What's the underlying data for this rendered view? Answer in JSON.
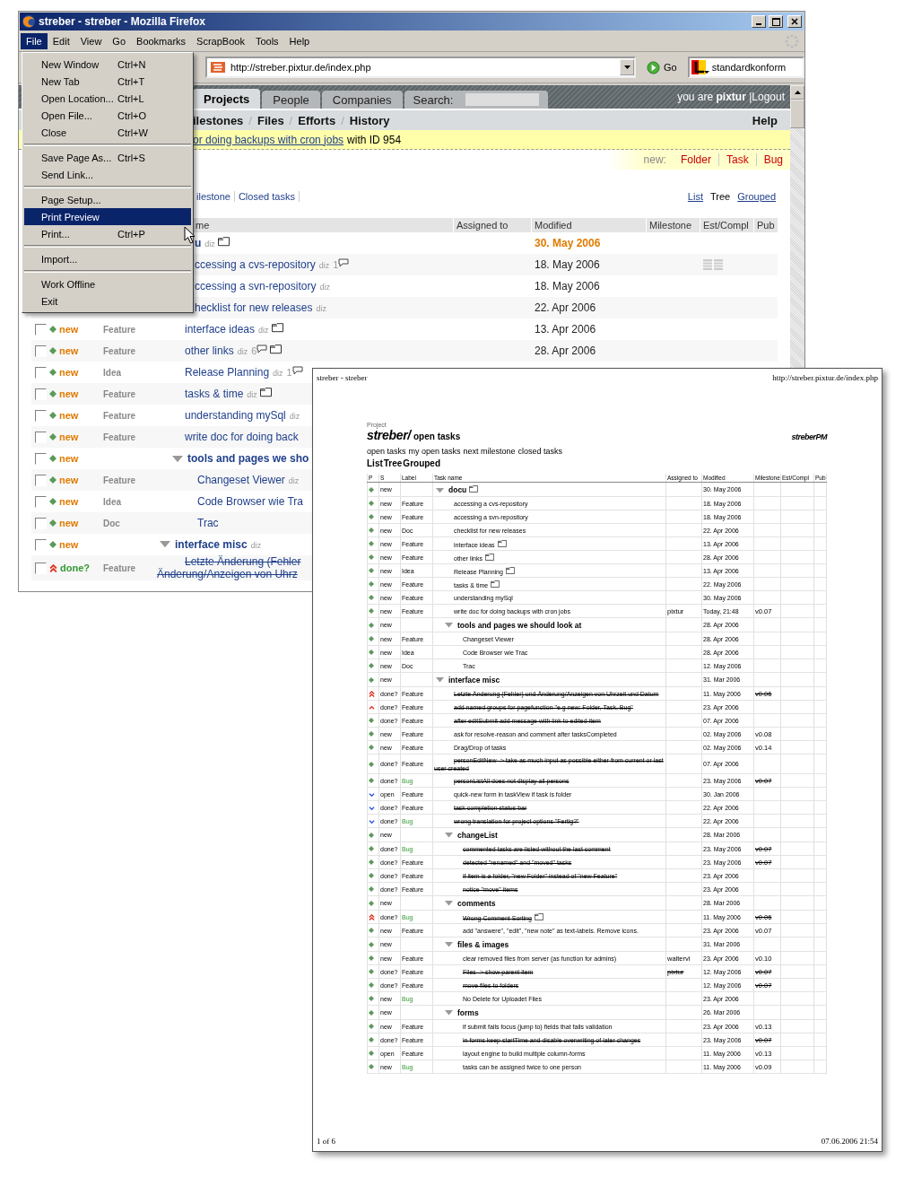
{
  "window": {
    "title": "streber - streber - Mozilla Firefox"
  },
  "menu_bar": [
    {
      "label": "File",
      "selected": true
    },
    {
      "label": "Edit",
      "selected": false
    },
    {
      "label": "View",
      "selected": false
    },
    {
      "label": "Go",
      "selected": false
    },
    {
      "label": "Bookmarks",
      "selected": false
    },
    {
      "label": "ScrapBook",
      "selected": false
    },
    {
      "label": "Tools",
      "selected": false
    },
    {
      "label": "Help",
      "selected": false
    }
  ],
  "file_menu": [
    [
      {
        "label": "New Window",
        "shortcut": "Ctrl+N",
        "selected": false
      },
      {
        "label": "New Tab",
        "shortcut": "Ctrl+T",
        "selected": false
      },
      {
        "label": "Open Location...",
        "shortcut": "Ctrl+L",
        "selected": false
      },
      {
        "label": "Open File...",
        "shortcut": "Ctrl+O",
        "selected": false
      },
      {
        "label": "Close",
        "shortcut": "Ctrl+W",
        "selected": false
      }
    ],
    [
      {
        "label": "Save Page As...",
        "shortcut": "Ctrl+S",
        "selected": false
      },
      {
        "label": "Send Link...",
        "selected": false
      }
    ],
    [
      {
        "label": "Page Setup...",
        "selected": false
      },
      {
        "label": "Print Preview",
        "selected": true
      },
      {
        "label": "Print...",
        "shortcut": "Ctrl+P",
        "selected": false
      }
    ],
    [
      {
        "label": "Import...",
        "selected": false
      }
    ],
    [
      {
        "label": "Work Offline",
        "selected": false
      },
      {
        "label": "Exit",
        "selected": false
      }
    ]
  ],
  "toolbar": {
    "url": "http://streber.pixtur.de/index.php",
    "go": "Go",
    "search_engine": "standardkonform"
  },
  "page": {
    "tabs": [
      {
        "label": "Projects",
        "selected": true
      },
      {
        "label": "People",
        "selected": false
      },
      {
        "label": "Companies",
        "selected": false
      }
    ],
    "search": {
      "label": "Search:"
    },
    "user": {
      "text": "you are **pixtur**",
      "logout": "|Logout"
    },
    "subnav": [
      {
        "label": "ilestones"
      },
      {
        "separator": "/",
        "label": "Files"
      },
      {
        "separator": "/",
        "label": "Efforts"
      },
      {
        "separator": "/",
        "label": "History"
      }
    ],
    "help": "Help",
    "message": {
      "link": "or doing backups with cron jobs",
      "text": "with ID 954"
    },
    "new_bar": {
      "label": "new:",
      "links": [
        "Folder",
        "Task",
        "Bug"
      ]
    },
    "view_tabs": [
      "ilestone",
      "Closed tasks"
    ],
    "view_modes": [
      {
        "label": "List",
        "selected": false
      },
      {
        "label": "Tree",
        "selected": true
      },
      {
        "label": "Grouped",
        "selected": false
      }
    ],
    "table": {
      "columns": [
        "me",
        "Assigned to",
        "Modified",
        "Milestone",
        "Est/Compl",
        "Pub"
      ],
      "rows": [
        {
          "kind": "folder",
          "name": "u",
          "diz": "diz",
          "folder_icon": true,
          "est_icon": false,
          "modified": "30. May 2006",
          "children": [
            {
              "kind": "task",
              "name": "ccessing a cvs-repository",
              "diz": "diz",
              "comments": "1",
              "folder_icon": false,
              "est_icon": true,
              "modified": "18. May 2006"
            },
            {
              "kind": "task",
              "name": "ccessing a svn-repository",
              "diz": "diz",
              "folder_icon": false,
              "est_icon": false,
              "modified": "18. May 2006"
            },
            {
              "kind": "task",
              "name": "hecklist for new releases",
              "diz": "diz",
              "folder_icon": false,
              "est_icon": false,
              "modified": "22. Apr 2006"
            },
            {
              "kind": "task",
              "checked": false,
              "priority": {
                "kind": "normal"
              },
              "status": "new",
              "label": "Feature",
              "name": "interface ideas",
              "diz": "diz",
              "folder_icon": true,
              "est_icon": false,
              "modified": "13. Apr 2006"
            },
            {
              "kind": "task",
              "checked": false,
              "priority": {
                "kind": "normal"
              },
              "status": "new",
              "label": "Feature",
              "name": "other links",
              "diz": "diz",
              "comments": "6",
              "folder_icon": true,
              "est_icon": false,
              "modified": "28. Apr 2006"
            },
            {
              "kind": "task",
              "checked": false,
              "priority": {
                "kind": "normal"
              },
              "status": "new",
              "label": "Idea",
              "name": "Release Planning",
              "diz": "diz",
              "comments": "1",
              "folder_icon": false,
              "est_icon": false
            },
            {
              "kind": "task",
              "checked": false,
              "priority": {
                "kind": "normal"
              },
              "status": "new",
              "label": "Feature",
              "name": "tasks & time",
              "diz": "diz",
              "folder_icon": true,
              "est_icon": false
            },
            {
              "kind": "task",
              "checked": false,
              "priority": {
                "kind": "normal"
              },
              "status": "new",
              "label": "Feature",
              "name": "understanding mySql",
              "diz": "diz",
              "folder_icon": false,
              "est_icon": false
            },
            {
              "kind": "task",
              "checked": false,
              "priority": {
                "kind": "normal"
              },
              "status": "new",
              "label": "Feature",
              "name": "write doc for doing back",
              "folder_icon": false,
              "est_icon": false
            },
            {
              "kind": "folder",
              "checked": false,
              "priority": {
                "kind": "normal"
              },
              "status": "new",
              "name": "tools and pages we sho",
              "folder_icon": false,
              "est_icon": false,
              "children": [
                {
                  "kind": "task",
                  "checked": false,
                  "priority": {
                    "kind": "normal"
                  },
                  "status": "new",
                  "label": "Feature",
                  "name": "Changeset Viewer",
                  "diz": "diz",
                  "folder_icon": false,
                  "est_icon": false
                },
                {
                  "kind": "task",
                  "checked": false,
                  "priority": {
                    "kind": "normal"
                  },
                  "status": "new",
                  "label": "Idea",
                  "name": "Code Browser wie Tra",
                  "folder_icon": false,
                  "est_icon": false
                },
                {
                  "kind": "task",
                  "checked": false,
                  "priority": {
                    "kind": "normal"
                  },
                  "status": "new",
                  "label": "Doc",
                  "name": "Trac",
                  "folder_icon": false,
                  "est_icon": false
                }
              ]
            }
          ]
        },
        {
          "kind": "folder",
          "checked": false,
          "priority": {
            "kind": "normal"
          },
          "status": "new",
          "name": "interface misc",
          "diz": "diz",
          "folder_icon": false,
          "est_icon": false,
          "children": [
            {
              "kind": "task",
              "checked": false,
              "priority": {
                "kind": "high"
              },
              "status": "done?",
              "label": "Feature",
              "name": "Letzte Änderung (Fehler Änderung/Anzeigen von Uhrz",
              "done": true,
              "folder_icon": false,
              "est_icon": false
            }
          ]
        }
      ]
    }
  },
  "print_preview": {
    "page_title": "streber - streber",
    "page_url": "http://streber.pixtur.de/index.php",
    "project_label": "Project",
    "project": "streber/",
    "title": "open tasks",
    "logo": "streberPM",
    "nav": [
      "open tasks",
      "my open tasks",
      "next milestone",
      "closed tasks"
    ],
    "views": [
      "List",
      "Tree",
      "Grouped"
    ],
    "columns": [
      "P",
      "S",
      "Label",
      "Task name",
      "Assigned to",
      "Modified",
      "Milestone",
      "Est/Compl",
      "Pub"
    ],
    "rows": [
      {
        "kind": "folder",
        "priority": {
          "kind": "normal"
        },
        "status": "new",
        "name": "docu",
        "folder_icon": true,
        "done": false,
        "modified": "30. May 2006",
        "children": [
          {
            "kind": "task",
            "priority": {
              "kind": "normal"
            },
            "status": "new",
            "label": "Feature",
            "name": "accessing a cvs-repository",
            "done": false,
            "modified": "18. May 2006"
          },
          {
            "kind": "task",
            "priority": {
              "kind": "normal"
            },
            "status": "new",
            "label": "Feature",
            "name": "accessing a svn-repository",
            "done": false,
            "modified": "18. May 2006"
          },
          {
            "kind": "task",
            "priority": {
              "kind": "normal"
            },
            "status": "new",
            "label": "Doc",
            "name": "checklist for new releases",
            "done": false,
            "modified": "22. Apr 2006"
          },
          {
            "kind": "task",
            "priority": {
              "kind": "normal"
            },
            "status": "new",
            "label": "Feature",
            "name": "interface ideas",
            "folder_icon": true,
            "done": false,
            "modified": "13. Apr 2006"
          },
          {
            "kind": "task",
            "priority": {
              "kind": "normal"
            },
            "status": "new",
            "label": "Feature",
            "name": "other links",
            "folder_icon": true,
            "done": false,
            "modified": "28. Apr 2006"
          },
          {
            "kind": "task",
            "priority": {
              "kind": "normal"
            },
            "status": "new",
            "label": "Idea",
            "name": "Release Planning",
            "folder_icon": true,
            "done": false,
            "modified": "13. Apr 2006"
          },
          {
            "kind": "task",
            "priority": {
              "kind": "normal"
            },
            "status": "new",
            "label": "Feature",
            "name": "tasks & time",
            "folder_icon": true,
            "done": false,
            "modified": "22. May 2006"
          },
          {
            "kind": "task",
            "priority": {
              "kind": "normal"
            },
            "status": "new",
            "label": "Feature",
            "name": "understanding mySql",
            "done": false,
            "modified": "30. May 2006"
          },
          {
            "kind": "task",
            "priority": {
              "kind": "normal"
            },
            "status": "new",
            "label": "Feature",
            "name": "write doc for doing backups with cron jobs",
            "done": false,
            "assigned": "pixtur",
            "modified": "Today, 21:48",
            "milestone": "v0.07"
          },
          {
            "kind": "folder",
            "priority": {
              "kind": "normal"
            },
            "status": "new",
            "name": "tools and pages we should look at",
            "done": false,
            "modified": "28. Apr 2006",
            "children": [
              {
                "kind": "task",
                "priority": {
                  "kind": "normal"
                },
                "status": "new",
                "label": "Feature",
                "name": "Changeset Viewer",
                "done": false,
                "modified": "28. Apr 2006"
              },
              {
                "kind": "task",
                "priority": {
                  "kind": "normal"
                },
                "status": "new",
                "label": "Idea",
                "name": "Code Browser wie Trac",
                "done": false,
                "modified": "28. Apr 2006"
              },
              {
                "kind": "task",
                "priority": {
                  "kind": "normal"
                },
                "status": "new",
                "label": "Doc",
                "name": "Trac",
                "done": false,
                "modified": "12. May 2006"
              }
            ]
          }
        ]
      },
      {
        "kind": "folder",
        "priority": {
          "kind": "normal"
        },
        "status": "new",
        "name": "interface misc",
        "done": false,
        "modified": "31. Mar 2006",
        "children": [
          {
            "kind": "task",
            "priority": {
              "kind": "high"
            },
            "status": "done?",
            "label": "Feature",
            "name": "Letzte Änderung (Fehler) und Änderung/Anzeigen von Uhrzeit und Datum",
            "done": true,
            "modified": "11. May 2006",
            "milestone": "v0.06"
          },
          {
            "kind": "task",
            "priority": {
              "kind": "raised"
            },
            "status": "done?",
            "label": "Feature",
            "name": "add named groups for pagefunction \"e.g new: Folder, Task, Bug\"",
            "done": true,
            "modified": "23. Apr 2006"
          },
          {
            "kind": "task",
            "priority": {
              "kind": "normal"
            },
            "status": "done?",
            "label": "Feature",
            "name": "after editSubmit add message with link to edited item",
            "done": true,
            "modified": "07. Apr 2006"
          },
          {
            "kind": "task",
            "priority": {
              "kind": "normal"
            },
            "status": "new",
            "label": "Feature",
            "name": "ask for resolve-reason and comment after tasksCompleted",
            "done": false,
            "modified": "02. May 2006",
            "milestone": "v0.08"
          },
          {
            "kind": "task",
            "priority": {
              "kind": "normal"
            },
            "status": "new",
            "label": "Feature",
            "name": "Drag/Drop of tasks",
            "done": false,
            "modified": "02. May 2006",
            "milestone": "v0.14"
          },
          {
            "kind": "task",
            "priority": {
              "kind": "normal"
            },
            "status": "done?",
            "label": "Feature",
            "name": "personEditNew -> take as much input as possible either from current or last user created",
            "done": true,
            "modified": "07. Apr 2006"
          },
          {
            "kind": "bug",
            "priority": {
              "kind": "normal"
            },
            "status": "done?",
            "label": "Bug",
            "name": "personListAll does not display all persons",
            "done": true,
            "modified": "23. May 2006",
            "milestone": "v0.07"
          },
          {
            "kind": "task",
            "priority": {
              "kind": "low"
            },
            "status": "open",
            "label": "Feature",
            "name": "quick-new form in taskView if task is folder",
            "done": false,
            "modified": "30. Jan 2006"
          },
          {
            "kind": "task",
            "priority": {
              "kind": "low"
            },
            "status": "done?",
            "label": "Feature",
            "name": "task completion status bar",
            "done": true,
            "modified": "22. Apr 2006"
          },
          {
            "kind": "bug",
            "priority": {
              "kind": "low"
            },
            "status": "done?",
            "label": "Bug",
            "name": "wrong translation for project options \"Fertig?\"",
            "done": true,
            "modified": "22. Apr 2006"
          },
          {
            "kind": "folder",
            "priority": {
              "kind": "normal"
            },
            "status": "new",
            "name": "changeList",
            "done": false,
            "modified": "28. Mar 2006",
            "children": [
              {
                "kind": "bug",
                "priority": {
                  "kind": "normal"
                },
                "status": "done?",
                "label": "Bug",
                "name": "commented tasks are listed without the last comment",
                "done": true,
                "modified": "23. May 2006",
                "milestone": "v0.07"
              },
              {
                "kind": "task",
                "priority": {
                  "kind": "normal"
                },
                "status": "done?",
                "label": "Feature",
                "name": "detected \"renamed\" and \"moved\" tasks",
                "done": true,
                "modified": "23. May 2006",
                "milestone": "v0.07"
              },
              {
                "kind": "task",
                "priority": {
                  "kind": "normal"
                },
                "status": "done?",
                "label": "Feature",
                "name": "if item is a folder, \"new Folder\" instead of \"new Feature\"",
                "done": true,
                "modified": "23. Apr 2006"
              },
              {
                "kind": "task",
                "priority": {
                  "kind": "normal"
                },
                "status": "done?",
                "label": "Feature",
                "name": "notice \"move\" items",
                "done": true,
                "modified": "23. Apr 2006"
              }
            ]
          },
          {
            "kind": "folder",
            "priority": {
              "kind": "normal"
            },
            "status": "new",
            "name": "comments",
            "done": false,
            "modified": "28. Mar 2006",
            "children": [
              {
                "kind": "bug",
                "priority": {
                  "kind": "high"
                },
                "status": "done?",
                "label": "Bug",
                "name": "Wrong Comment Sorting",
                "folder_icon": true,
                "done": true,
                "modified": "11. May 2006",
                "milestone": "v0.06"
              },
              {
                "kind": "task",
                "priority": {
                  "kind": "normal"
                },
                "status": "new",
                "label": "Feature",
                "name": "add \"answere\", \"edit\", \"new note\" as text-labels. Remove icons.",
                "done": false,
                "modified": "23. Apr 2006",
                "milestone": "v0.07"
              }
            ]
          },
          {
            "kind": "folder",
            "priority": {
              "kind": "normal"
            },
            "status": "new",
            "name": "files & images",
            "done": false,
            "modified": "31. Mar 2006",
            "children": [
              {
                "kind": "task",
                "priority": {
                  "kind": "normal"
                },
                "status": "new",
                "label": "Feature",
                "name": "clear removed files from server (as function for admins)",
                "done": false,
                "assigned": "waltervi",
                "modified": "23. Apr 2006",
                "milestone": "v0.10"
              },
              {
                "kind": "task",
                "priority": {
                  "kind": "normal"
                },
                "status": "done?",
                "label": "Feature",
                "name": "Files -> show parent item",
                "done": true,
                "assigned": "pixtur",
                "modified": "12. May 2006",
                "milestone": "v0.07"
              },
              {
                "kind": "task",
                "priority": {
                  "kind": "normal"
                },
                "status": "done?",
                "label": "Feature",
                "name": "move files to folders",
                "done": true,
                "modified": "12. May 2006",
                "milestone": "v0.07"
              },
              {
                "kind": "bug",
                "priority": {
                  "kind": "normal"
                },
                "status": "new",
                "label": "Bug",
                "name": "No Delete for Uploadet Files",
                "done": false,
                "modified": "23. Apr 2006"
              }
            ]
          },
          {
            "kind": "folder",
            "priority": {
              "kind": "normal"
            },
            "status": "new",
            "name": "forms",
            "done": false,
            "modified": "26. Mar 2006",
            "children": [
              {
                "kind": "task",
                "priority": {
                  "kind": "normal"
                },
                "status": "new",
                "label": "Feature",
                "name": "if submit fails focus (jump to) fields that fails validation",
                "done": false,
                "modified": "23. Apr 2006",
                "milestone": "v0.13"
              },
              {
                "kind": "task",
                "priority": {
                  "kind": "normal"
                },
                "status": "done?",
                "label": "Feature",
                "name": "in forms keep startTime and disable overwriting of later changes",
                "done": true,
                "modified": "23. May 2006",
                "milestone": "v0.07"
              },
              {
                "kind": "task",
                "priority": {
                  "kind": "normal"
                },
                "status": "open",
                "label": "Feature",
                "name": "layout engine to build multiple column-forms",
                "done": false,
                "modified": "11. May 2006",
                "milestone": "v0.13"
              },
              {
                "kind": "bug",
                "priority": {
                  "kind": "normal"
                },
                "status": "new",
                "label": "Bug",
                "name": "tasks can be assigned twice to one person",
                "done": false,
                "modified": "11. May 2006",
                "milestone": "v0.09"
              }
            ]
          }
        ]
      }
    ],
    "footer_left": "1 of 6",
    "footer_right": "07.06.2006 21:54"
  }
}
